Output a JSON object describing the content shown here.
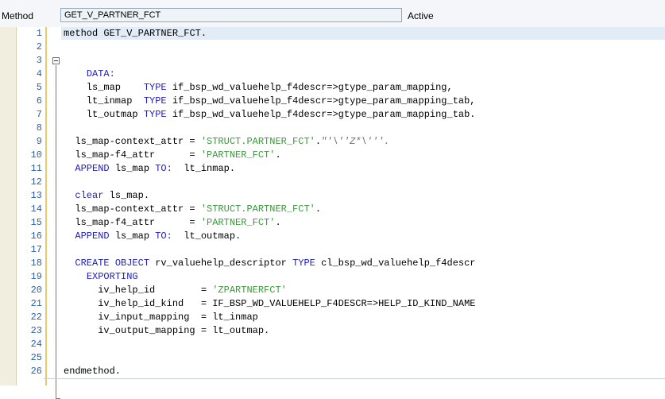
{
  "header": {
    "method_label": "Method",
    "method_name": "GET_V_PARTNER_FCT",
    "status": "Active"
  },
  "editor": {
    "lines": [
      {
        "n": "1",
        "tokens": [
          {
            "t": "method ",
            "c": "plain"
          },
          {
            "t": "GET_V_PARTNER_FCT.",
            "c": "plain"
          }
        ]
      },
      {
        "n": "2",
        "tokens": []
      },
      {
        "n": "3",
        "tokens": []
      },
      {
        "n": "4",
        "tokens": [
          {
            "t": "    ",
            "c": "plain"
          },
          {
            "t": "DATA:",
            "c": "kw"
          }
        ]
      },
      {
        "n": "5",
        "tokens": [
          {
            "t": "    ls_map    ",
            "c": "plain"
          },
          {
            "t": "TYPE",
            "c": "kw"
          },
          {
            "t": " if_bsp_wd_valuehelp_f4descr=>gtype_param_mapping,",
            "c": "plain"
          }
        ]
      },
      {
        "n": "6",
        "tokens": [
          {
            "t": "    lt_inmap  ",
            "c": "plain"
          },
          {
            "t": "TYPE",
            "c": "kw"
          },
          {
            "t": " if_bsp_wd_valuehelp_f4descr=>gtype_param_mapping_tab,",
            "c": "plain"
          }
        ]
      },
      {
        "n": "7",
        "tokens": [
          {
            "t": "    lt_outmap ",
            "c": "plain"
          },
          {
            "t": "TYPE",
            "c": "kw"
          },
          {
            "t": " if_bsp_wd_valuehelp_f4descr=>gtype_param_mapping_tab.",
            "c": "plain"
          }
        ]
      },
      {
        "n": "8",
        "tokens": []
      },
      {
        "n": "9",
        "tokens": [
          {
            "t": "  ls_map-context_attr = ",
            "c": "plain"
          },
          {
            "t": "'STRUCT.PARTNER_FCT'",
            "c": "str"
          },
          {
            "t": ".",
            "c": "plain"
          },
          {
            "t": "\"'\\''Z*\\'''.",
            "c": "cmt"
          }
        ]
      },
      {
        "n": "10",
        "tokens": [
          {
            "t": "  ls_map-f4_attr      = ",
            "c": "plain"
          },
          {
            "t": "'PARTNER_FCT'",
            "c": "str"
          },
          {
            "t": ".",
            "c": "plain"
          }
        ]
      },
      {
        "n": "11",
        "tokens": [
          {
            "t": "  ",
            "c": "plain"
          },
          {
            "t": "APPEND",
            "c": "kw"
          },
          {
            "t": " ls_map ",
            "c": "plain"
          },
          {
            "t": "TO:",
            "c": "kw"
          },
          {
            "t": "  lt_inmap.",
            "c": "plain"
          }
        ]
      },
      {
        "n": "12",
        "tokens": []
      },
      {
        "n": "13",
        "tokens": [
          {
            "t": "  ",
            "c": "plain"
          },
          {
            "t": "clear",
            "c": "kw"
          },
          {
            "t": " ls_map.",
            "c": "plain"
          }
        ]
      },
      {
        "n": "14",
        "tokens": [
          {
            "t": "  ls_map-context_attr = ",
            "c": "plain"
          },
          {
            "t": "'STRUCT.PARTNER_FCT'",
            "c": "str"
          },
          {
            "t": ".",
            "c": "plain"
          }
        ]
      },
      {
        "n": "15",
        "tokens": [
          {
            "t": "  ls_map-f4_attr      = ",
            "c": "plain"
          },
          {
            "t": "'PARTNER_FCT'",
            "c": "str"
          },
          {
            "t": ".",
            "c": "plain"
          }
        ]
      },
      {
        "n": "16",
        "tokens": [
          {
            "t": "  ",
            "c": "plain"
          },
          {
            "t": "APPEND",
            "c": "kw"
          },
          {
            "t": " ls_map ",
            "c": "plain"
          },
          {
            "t": "TO:",
            "c": "kw"
          },
          {
            "t": "  lt_outmap.",
            "c": "plain"
          }
        ]
      },
      {
        "n": "17",
        "tokens": []
      },
      {
        "n": "18",
        "tokens": [
          {
            "t": "  ",
            "c": "plain"
          },
          {
            "t": "CREATE OBJECT",
            "c": "kw"
          },
          {
            "t": " rv_valuehelp_descriptor ",
            "c": "plain"
          },
          {
            "t": "TYPE",
            "c": "kw"
          },
          {
            "t": " cl_bsp_wd_valuehelp_f4descr",
            "c": "plain"
          }
        ]
      },
      {
        "n": "19",
        "tokens": [
          {
            "t": "    ",
            "c": "plain"
          },
          {
            "t": "EXPORTING",
            "c": "kw"
          }
        ]
      },
      {
        "n": "20",
        "tokens": [
          {
            "t": "      iv_help_id        = ",
            "c": "plain"
          },
          {
            "t": "'ZPARTNERFCT'",
            "c": "str"
          }
        ]
      },
      {
        "n": "21",
        "tokens": [
          {
            "t": "      iv_help_id_kind   = IF_BSP_WD_VALUEHELP_F4DESCR=>HELP_ID_KIND_NAME",
            "c": "plain"
          }
        ]
      },
      {
        "n": "22",
        "tokens": [
          {
            "t": "      iv_input_mapping  = lt_inmap",
            "c": "plain"
          }
        ]
      },
      {
        "n": "23",
        "tokens": [
          {
            "t": "      iv_output_mapping = lt_outmap.",
            "c": "plain"
          }
        ]
      },
      {
        "n": "24",
        "tokens": []
      },
      {
        "n": "25",
        "tokens": []
      },
      {
        "n": "26",
        "tokens": [
          {
            "t": "endmethod.",
            "c": "plain"
          }
        ]
      }
    ],
    "colors": {
      "keyword": "#1c1cc8",
      "string": "#3b9a3b",
      "comment": "#707070",
      "line_number": "#2a5fa8"
    }
  }
}
